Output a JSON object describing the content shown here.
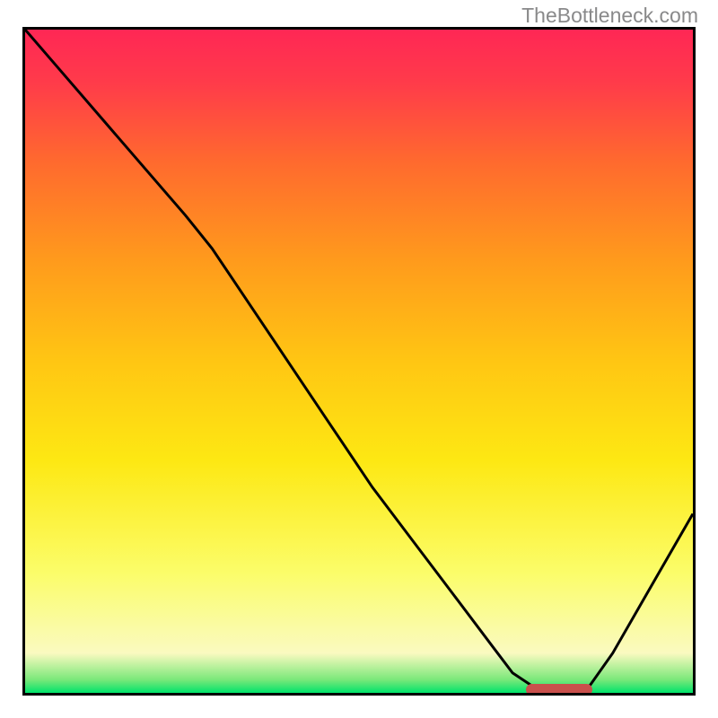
{
  "watermark": "TheBottleneck.com",
  "chart_data": {
    "type": "line",
    "title": "",
    "xlabel": "",
    "ylabel": "",
    "x_range": [
      0,
      100
    ],
    "y_range": [
      0,
      100
    ],
    "gradient_bands": [
      {
        "color": "#00e36b",
        "stop": 0
      },
      {
        "color": "#7be87a",
        "stop": 2
      },
      {
        "color": "#fafac0",
        "stop": 6
      },
      {
        "color": "#fbfd6a",
        "stop": 18
      },
      {
        "color": "#fde813",
        "stop": 35
      },
      {
        "color": "#ffc613",
        "stop": 50
      },
      {
        "color": "#ff9b1c",
        "stop": 65
      },
      {
        "color": "#ff6a2e",
        "stop": 80
      },
      {
        "color": "#ff3b4a",
        "stop": 92
      },
      {
        "color": "#ff2755",
        "stop": 100
      }
    ],
    "series": [
      {
        "name": "curve",
        "stroke": "#000000",
        "stroke_width": 3,
        "x": [
          0,
          6,
          12,
          18,
          24,
          28,
          34,
          40,
          46,
          52,
          58,
          64,
          70,
          73,
          76,
          80,
          84,
          88,
          92,
          96,
          100
        ],
        "y": [
          100,
          93,
          86,
          79,
          72,
          67,
          58,
          49,
          40,
          31,
          23,
          15,
          7,
          3,
          1,
          0.3,
          0.3,
          6,
          13,
          20,
          27
        ]
      }
    ],
    "marker": {
      "x_start": 75,
      "x_end": 85,
      "y": 0.6,
      "color": "#c9504c"
    }
  }
}
